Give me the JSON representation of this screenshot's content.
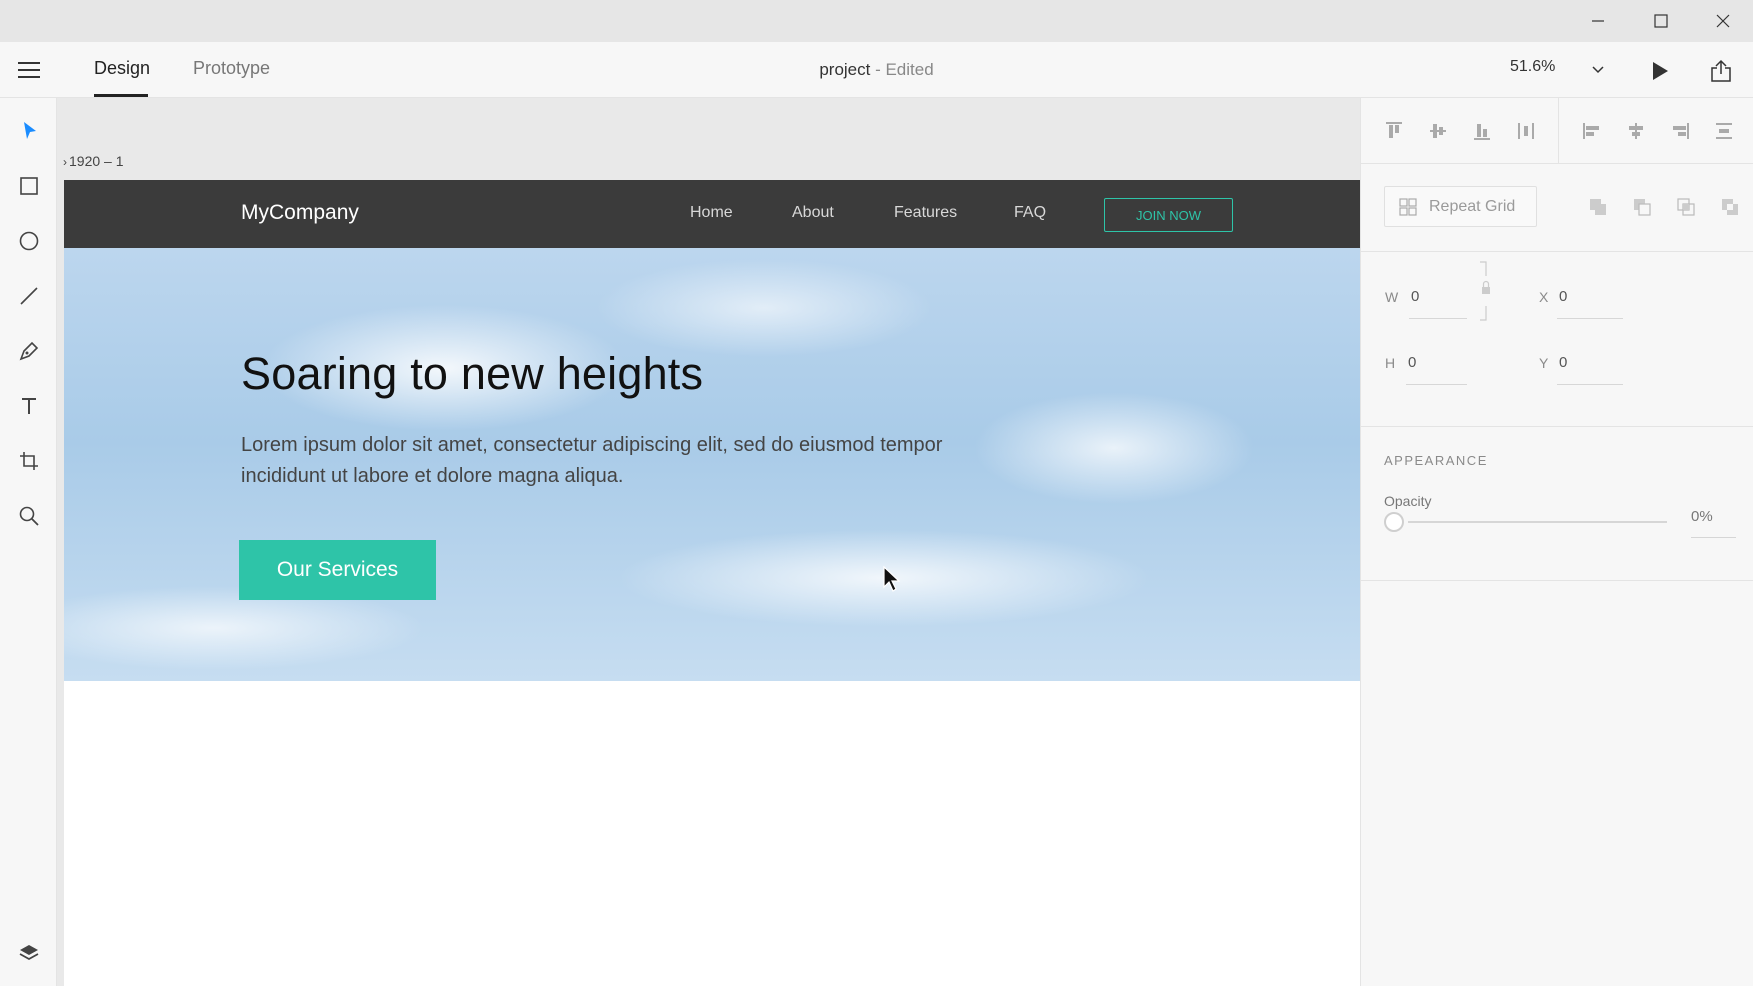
{
  "toolbar": {
    "tabs": [
      {
        "label": "Design",
        "active": true
      },
      {
        "label": "Prototype",
        "active": false
      }
    ],
    "doc_title": "project",
    "doc_status": " - Edited",
    "zoom": "51.6%"
  },
  "tools": [
    "select-tool",
    "rectangle-tool",
    "ellipse-tool",
    "line-tool",
    "pen-tool",
    "text-tool",
    "artboard-tool",
    "zoom-tool",
    "layers"
  ],
  "canvas": {
    "artboard_label": "1920 – 1",
    "site": {
      "brand": "MyCompany",
      "nav": [
        "Home",
        "About",
        "Features",
        "FAQ"
      ],
      "join_label": "JOIN NOW",
      "hero_title": "Soaring to new heights",
      "hero_text": "Lorem ipsum dolor sit amet, consectetur adipiscing elit, sed do eiusmod tempor incididunt ut labore et dolore magna aliqua.",
      "cta_label": "Our Services"
    }
  },
  "panel": {
    "repeat_grid_label": "Repeat Grid",
    "w_label": "W",
    "w_value": "0",
    "h_label": "H",
    "h_value": "0",
    "x_label": "X",
    "x_value": "0",
    "y_label": "Y",
    "y_value": "0",
    "appearance_title": "APPEARANCE",
    "opacity_label": "Opacity",
    "opacity_value": "0%"
  },
  "colors": {
    "accent": "#2ec4a8",
    "select_tool": "#1a8cff",
    "nav_bar": "#3b3b3b"
  }
}
